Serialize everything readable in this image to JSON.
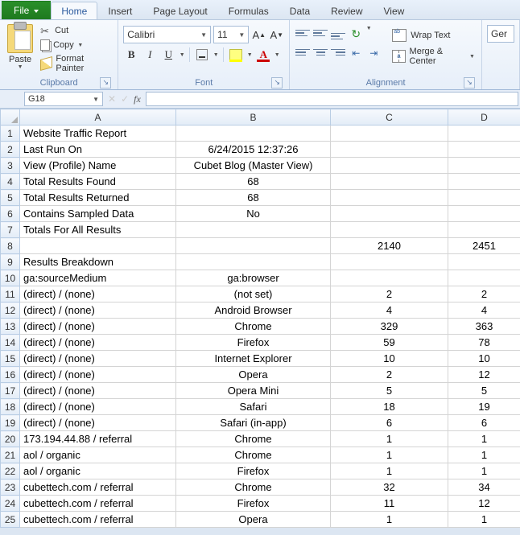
{
  "tabs": {
    "file": "File",
    "home": "Home",
    "insert": "Insert",
    "page_layout": "Page Layout",
    "formulas": "Formulas",
    "data": "Data",
    "review": "Review",
    "view": "View"
  },
  "ribbon": {
    "clipboard": {
      "paste": "Paste",
      "cut": "Cut",
      "copy": "Copy",
      "format_painter": "Format Painter",
      "group_label": "Clipboard"
    },
    "font": {
      "name": "Calibri",
      "size": "11",
      "group_label": "Font"
    },
    "alignment": {
      "wrap": "Wrap Text",
      "merge": "Merge & Center",
      "group_label": "Alignment"
    },
    "general": {
      "label": "Ger"
    }
  },
  "namebox": "G18",
  "columns": [
    "A",
    "B",
    "C",
    "D"
  ],
  "rows": [
    {
      "n": "1",
      "a": "Website Traffic Report",
      "b": "",
      "c": "",
      "d": "",
      "al": "llrr"
    },
    {
      "n": "2",
      "a": "Last Run On",
      "b": "6/24/2015 12:37:26",
      "c": "",
      "d": "",
      "al": "lcrr"
    },
    {
      "n": "3",
      "a": "View (Profile) Name",
      "b": "Cubet Blog (Master View)",
      "c": "",
      "d": "",
      "al": "lcrr"
    },
    {
      "n": "4",
      "a": "Total Results Found",
      "b": "68",
      "c": "",
      "d": "",
      "al": "lcrr"
    },
    {
      "n": "5",
      "a": "Total Results Returned",
      "b": "68",
      "c": "",
      "d": "",
      "al": "lcrr"
    },
    {
      "n": "6",
      "a": "Contains Sampled Data",
      "b": "No",
      "c": "",
      "d": "",
      "al": "lcrr"
    },
    {
      "n": "7",
      "a": "Totals For All Results",
      "b": "",
      "c": "",
      "d": "",
      "al": "lcrr"
    },
    {
      "n": "8",
      "a": "",
      "b": "",
      "c": "2140",
      "d": "2451",
      "al": "lccc"
    },
    {
      "n": "9",
      "a": "Results Breakdown",
      "b": "",
      "c": "",
      "d": "",
      "al": "lcrr"
    },
    {
      "n": "10",
      "a": "ga:sourceMedium",
      "b": "ga:browser",
      "c": "",
      "d": "",
      "al": "lcrr"
    },
    {
      "n": "11",
      "a": "(direct) / (none)",
      "b": "(not set)",
      "c": "2",
      "d": "2",
      "al": "lccc"
    },
    {
      "n": "12",
      "a": "(direct) / (none)",
      "b": "Android Browser",
      "c": "4",
      "d": "4",
      "al": "lccc"
    },
    {
      "n": "13",
      "a": "(direct) / (none)",
      "b": "Chrome",
      "c": "329",
      "d": "363",
      "al": "lccc"
    },
    {
      "n": "14",
      "a": "(direct) / (none)",
      "b": "Firefox",
      "c": "59",
      "d": "78",
      "al": "lccc"
    },
    {
      "n": "15",
      "a": "(direct) / (none)",
      "b": "Internet Explorer",
      "c": "10",
      "d": "10",
      "al": "lccc"
    },
    {
      "n": "16",
      "a": "(direct) / (none)",
      "b": "Opera",
      "c": "2",
      "d": "12",
      "al": "lccc"
    },
    {
      "n": "17",
      "a": "(direct) / (none)",
      "b": "Opera Mini",
      "c": "5",
      "d": "5",
      "al": "lccc"
    },
    {
      "n": "18",
      "a": "(direct) / (none)",
      "b": "Safari",
      "c": "18",
      "d": "19",
      "al": "lccc"
    },
    {
      "n": "19",
      "a": "(direct) / (none)",
      "b": "Safari (in-app)",
      "c": "6",
      "d": "6",
      "al": "lccc"
    },
    {
      "n": "20",
      "a": "173.194.44.88 / referral",
      "b": "Chrome",
      "c": "1",
      "d": "1",
      "al": "lccc"
    },
    {
      "n": "21",
      "a": "aol / organic",
      "b": "Chrome",
      "c": "1",
      "d": "1",
      "al": "lccc"
    },
    {
      "n": "22",
      "a": "aol / organic",
      "b": "Firefox",
      "c": "1",
      "d": "1",
      "al": "lccc"
    },
    {
      "n": "23",
      "a": "cubettech.com / referral",
      "b": "Chrome",
      "c": "32",
      "d": "34",
      "al": "lccc"
    },
    {
      "n": "24",
      "a": "cubettech.com / referral",
      "b": "Firefox",
      "c": "11",
      "d": "12",
      "al": "lccc"
    },
    {
      "n": "25",
      "a": "cubettech.com / referral",
      "b": "Opera",
      "c": "1",
      "d": "1",
      "al": "lccc"
    }
  ]
}
